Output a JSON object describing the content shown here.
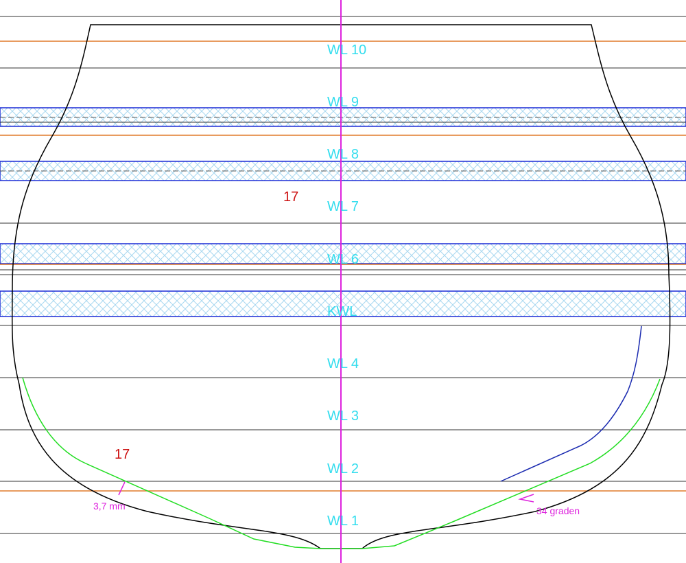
{
  "waterline_labels": {
    "wl10": "WL 10",
    "wl9": "WL 9",
    "wl8": "WL 8",
    "wl7": "WL 7",
    "wl6": "WL 6",
    "kwl": "KWL",
    "wl4": "WL 4",
    "wl3": "WL 3",
    "wl2": "WL 2",
    "wl1": "WL 1"
  },
  "annotations": {
    "upper_number": "17",
    "lower_number": "17",
    "thickness": "3,7 mm",
    "angle": "34 graden"
  },
  "colors": {
    "background": "#ffffff",
    "gridline": "#333333",
    "orange_line": "#e07a2a",
    "centerline": "#dd22dd",
    "hull_outline": "#000000",
    "hatch_band": "#1a2ad6",
    "hatch_fill": "#a8d8f0",
    "green_line": "#22dd22",
    "blue_line": "#1a2ab0",
    "waterline_label": "#33ddee",
    "red_label": "#cc1111",
    "magenta_label": "#dd22dd"
  }
}
